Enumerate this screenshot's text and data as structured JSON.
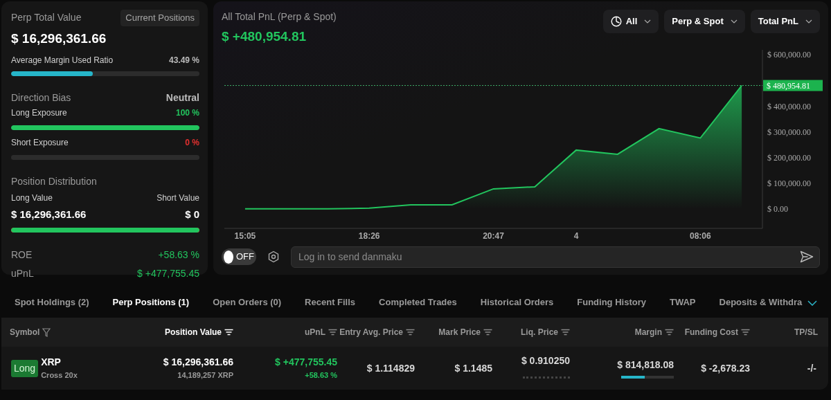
{
  "summary": {
    "title": "Perp Total Value",
    "view_button": "Current Positions",
    "value": "$ 16,296,361.66",
    "margin_ratio": {
      "label": "Average Margin Used Ratio",
      "value": "43.49 %",
      "level": 0.4349
    },
    "direction": {
      "label": "Direction Bias",
      "value": "Neutral"
    },
    "exposures": [
      {
        "label": "Long Exposure",
        "value": "100 %",
        "kind": "gain",
        "level": 1.0
      },
      {
        "label": "Short Exposure",
        "value": "0 %",
        "kind": "loss",
        "level": 0.0
      }
    ],
    "distribution": {
      "label": "Position Distribution",
      "long_label": "Long Value",
      "short_label": "Short Value",
      "long_value": "$ 16,296,361.66",
      "short_value": "$ 0",
      "level": 1.0
    },
    "stats": [
      {
        "label": "ROE",
        "value": "+58.63 %",
        "kind": "gain"
      },
      {
        "label": "uPnL",
        "value": "$ +477,755.45",
        "kind": "gain"
      }
    ]
  },
  "pnl": {
    "title": "All Total PnL (Perp & Spot)",
    "value": "$ +480,954.81",
    "filters": [
      {
        "label": "All",
        "kind": "clock"
      },
      {
        "label": "Perp & Spot",
        "kind": "plain"
      },
      {
        "label": "Total PnL",
        "kind": "plain"
      }
    ],
    "chart_data": {
      "type": "area",
      "categories": [
        "15:05",
        null,
        null,
        "18:26",
        null,
        null,
        "20:47",
        null,
        "4",
        null,
        null,
        "08:06",
        null
      ],
      "series": [
        {
          "color": "#22c55e",
          "values": [
            0,
            0,
            0,
            3000,
            16000,
            16000,
            78000,
            86000,
            229000,
            213000,
            313000,
            276000,
            480954.81
          ]
        }
      ],
      "ylim": [
        -76000,
        620000
      ],
      "ref_lines": [
        {
          "axis": "y",
          "value": 480954.81,
          "label": "$ 480,954.81"
        }
      ],
      "yticks": [
        {
          "value": 0,
          "label": "$ 0.00"
        },
        {
          "value": 100000,
          "label": "$ 100,000.00"
        },
        {
          "value": 200000,
          "label": "$ 200,000.00"
        },
        {
          "value": 300000,
          "label": "$ 300,000.00"
        },
        {
          "value": 400000,
          "label": "$ 400,000.00"
        },
        {
          "value": 600000,
          "label": "$ 600,000.00"
        }
      ]
    },
    "danmaku": {
      "on": false,
      "toggle_label": "OFF",
      "placeholder": "Log in to send danmaku"
    }
  },
  "tabs": [
    {
      "label": "Spot Holdings (2)",
      "selected": false
    },
    {
      "label": "Perp Positions (1)",
      "selected": true
    },
    {
      "label": "Open Orders (0)",
      "selected": false
    },
    {
      "label": "Recent Fills",
      "selected": false
    },
    {
      "label": "Completed Trades",
      "selected": false
    },
    {
      "label": "Historical Orders",
      "selected": false
    },
    {
      "label": "Funding History",
      "selected": false
    },
    {
      "label": "TWAP",
      "selected": false
    },
    {
      "label": "Deposits & Withdra",
      "selected": false
    }
  ],
  "table": {
    "columns": [
      {
        "label": "Symbol",
        "kind": "filter",
        "selected": false
      },
      {
        "label": "Position Value",
        "kind": "sort",
        "selected": true
      },
      {
        "label": "uPnL",
        "kind": "sort",
        "selected": false
      },
      {
        "label": "Entry Avg. Price",
        "kind": "sort",
        "selected": false
      },
      {
        "label": "Mark Price",
        "kind": "sort",
        "selected": false
      },
      {
        "label": "Liq. Price",
        "kind": "sort",
        "selected": false
      },
      {
        "label": "Margin",
        "kind": "sort",
        "selected": false
      },
      {
        "label": "Funding Cost",
        "kind": "sort",
        "selected": false
      },
      {
        "label": "TP/SL",
        "kind": "plain",
        "selected": false
      }
    ],
    "rows": [
      {
        "side": "Long",
        "symbol": "XRP",
        "leverage": "Cross 20x",
        "position_value": "$ 16,296,361.66",
        "size": "14,189,257 XRP",
        "upnl": "$ +477,755.45",
        "roe": "+58.63 %",
        "entry_price": "$ 1.114829",
        "mark_price": "$ 1.1485",
        "liq_price": "$ 0.910250",
        "margin": "$ 814,818.08",
        "margin_bar": {
          "level": 0.45
        },
        "funding_cost": "$ -2,678.23",
        "tpsl": "-/-"
      }
    ]
  }
}
